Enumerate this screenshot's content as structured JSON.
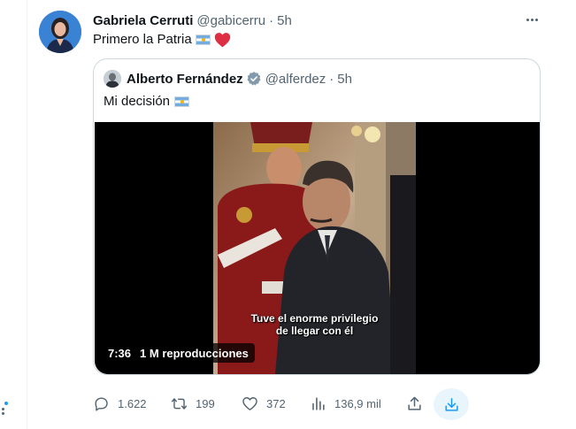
{
  "tweet": {
    "author_name": "Gabriela Cerruti",
    "author_handle": "@gabicerru",
    "separator": "·",
    "time": "5h",
    "text": "Primero la Patria",
    "emojis": [
      "argentina-flag",
      "red-heart"
    ]
  },
  "quote": {
    "author_name": "Alberto Fernández",
    "author_handle": "@alferdez",
    "separator": "·",
    "time": "5h",
    "text": "Mi decisión",
    "emojis": [
      "argentina-flag"
    ],
    "video": {
      "duration": "7:36",
      "views": "1 M reproducciones",
      "subtitle_line1": "Tuve el enorme privilegio",
      "subtitle_line2": "de llegar con él"
    }
  },
  "actions": {
    "replies": "1.622",
    "retweets": "199",
    "likes": "372",
    "views": "136,9 mil"
  },
  "colors": {
    "accent": "#1d9bf0",
    "text": "#0f1419",
    "secondary": "#536471",
    "border": "#cfd9de",
    "heart": "#f91880"
  },
  "icons": [
    "more-icon",
    "verified-badge-icon",
    "reply-icon",
    "retweet-icon",
    "like-icon",
    "views-icon",
    "share-icon",
    "download-icon"
  ]
}
